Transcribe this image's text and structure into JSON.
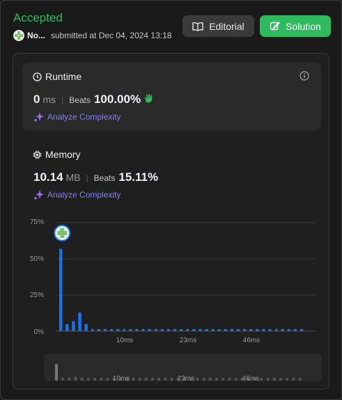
{
  "header": {
    "status": "Accepted",
    "username": "No...",
    "submitted": "submitted at Dec 04, 2024 13:18",
    "editorial_label": "Editorial",
    "solution_label": "Solution"
  },
  "runtime": {
    "title": "Runtime",
    "value": "0",
    "unit": "ms",
    "beats_label": "Beats",
    "beats_value": "100.00%",
    "analyze_label": "Analyze Complexity"
  },
  "memory": {
    "title": "Memory",
    "value": "10.14",
    "unit": "MB",
    "beats_label": "Beats",
    "beats_value": "15.11%",
    "analyze_label": "Analyze Complexity"
  },
  "colors": {
    "accent_green": "#2cbb5d",
    "bar_blue": "#1a73e8",
    "analyze_purple": "#8a7cf0"
  },
  "chart_data": {
    "type": "bar",
    "y_ticks": [
      "75%",
      "50%",
      "25%",
      "0%"
    ],
    "ylim": [
      0,
      75
    ],
    "x_tick_labels": [
      "10ms",
      "23ms",
      "46ms"
    ],
    "values": [
      57,
      5,
      7,
      13,
      5,
      1.5,
      1.5,
      1.5,
      1.5,
      1.5,
      1.5,
      1.5,
      1.5,
      1.5,
      1.5,
      1.5,
      1.5,
      1.5,
      1.5,
      1.5,
      1.5,
      1.5,
      1.5,
      1.5,
      1.5,
      1.5,
      1.5,
      1.5,
      1.5,
      1.5,
      1.5,
      1.5,
      1.5,
      1.5,
      1.5,
      1.5,
      1.5,
      1.5,
      1.5
    ],
    "highlight_index": 0,
    "grid": true
  },
  "minimap": {
    "x_tick_labels": [
      "10ms",
      "23ms",
      "46ms"
    ]
  }
}
